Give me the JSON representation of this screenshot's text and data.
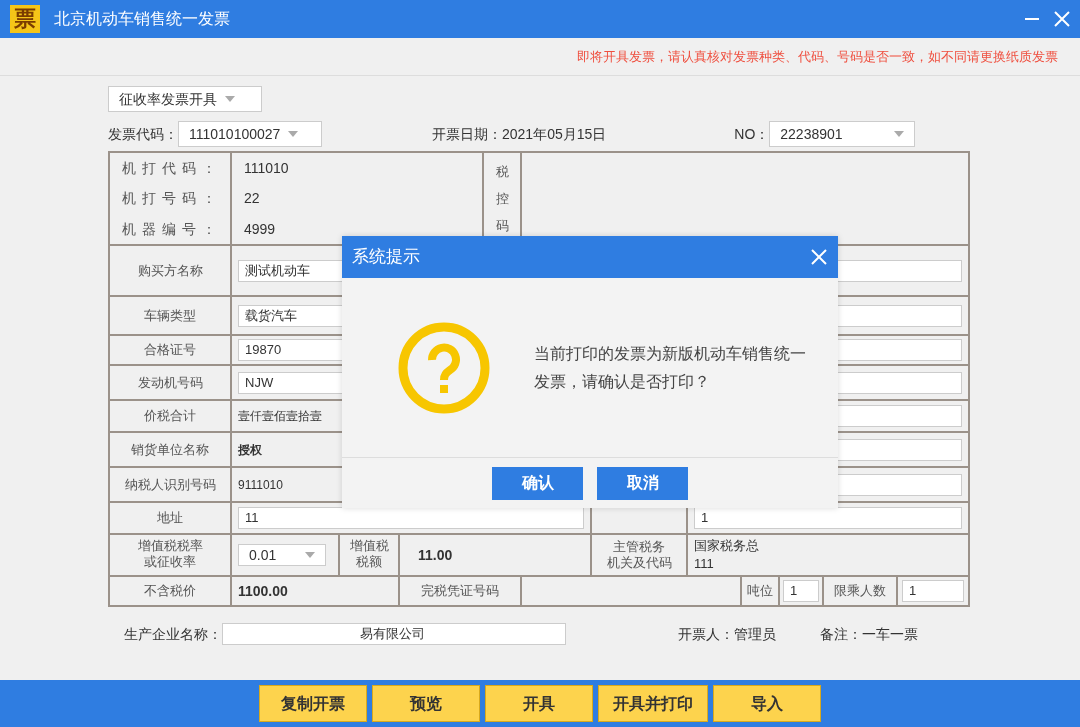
{
  "window": {
    "title": "北京机动车销售统一发票",
    "logo": "票"
  },
  "notice": "即将开具发票，请认真核对发票种类、代码、号码是否一致，如不同请更换纸质发票",
  "invoice_type": {
    "value": "征收率发票开具"
  },
  "header": {
    "code_label": "发票代码：",
    "code": "111010100027",
    "date": "开票日期：2021年05月15日",
    "no_label": "NO：",
    "no": "22238901"
  },
  "machine": [
    {
      "label": "机打代码：",
      "value": "111010"
    },
    {
      "label": "机打号码：",
      "value": "22"
    },
    {
      "label": "机器编号：",
      "value": "4999"
    }
  ],
  "tax_code_label": "税控码",
  "rows": [
    {
      "label": "购买方名称",
      "value": "测试机动车",
      "kind": "input"
    },
    {
      "label": "车辆类型",
      "value": "载货汽车",
      "kind": "input"
    },
    {
      "label": "合格证号",
      "value": "19870",
      "kind": "input"
    },
    {
      "label": "发动机号码",
      "value": "NJW",
      "kind": "input"
    },
    {
      "label": "价税合计",
      "value": "壹仟壹佰壹拾壹",
      "kind": "text"
    },
    {
      "label": "销货单位名称",
      "value": "授权",
      "kind": "text"
    },
    {
      "label": "纳税人识别号码",
      "value": "9111010",
      "kind": "text"
    },
    {
      "label": "地址",
      "value": "11",
      "kind": "input"
    }
  ],
  "bank_value": "1",
  "tax_row": {
    "rate_label": "增值税税率或征收率",
    "rate": "0.01",
    "amount_label": "增值税税额",
    "amount": "11.00",
    "authority_label": [
      "主管税务",
      "机关及代码"
    ],
    "authority": [
      "国家税务总",
      "111"
    ]
  },
  "price_row": {
    "label": "不含税价",
    "value": "1100.00",
    "voucher_label": "完税凭证号码",
    "tonnage_label": "吨位",
    "tonnage": "1",
    "seats_label": "限乘人数",
    "seats": "1"
  },
  "footer": {
    "producer_label": "生产企业名称：",
    "producer": "易有限公司",
    "issuer": "开票人：管理员",
    "remark": "备注：一车一票"
  },
  "dialog": {
    "title": "系统提示",
    "message": "当前打印的发票为新版机动车销售统一发票，请确认是否打印？",
    "buttons": [
      "确认",
      "取消"
    ]
  },
  "actions": [
    "复制开票",
    "预览",
    "开具",
    "开具并打印",
    "导入"
  ]
}
